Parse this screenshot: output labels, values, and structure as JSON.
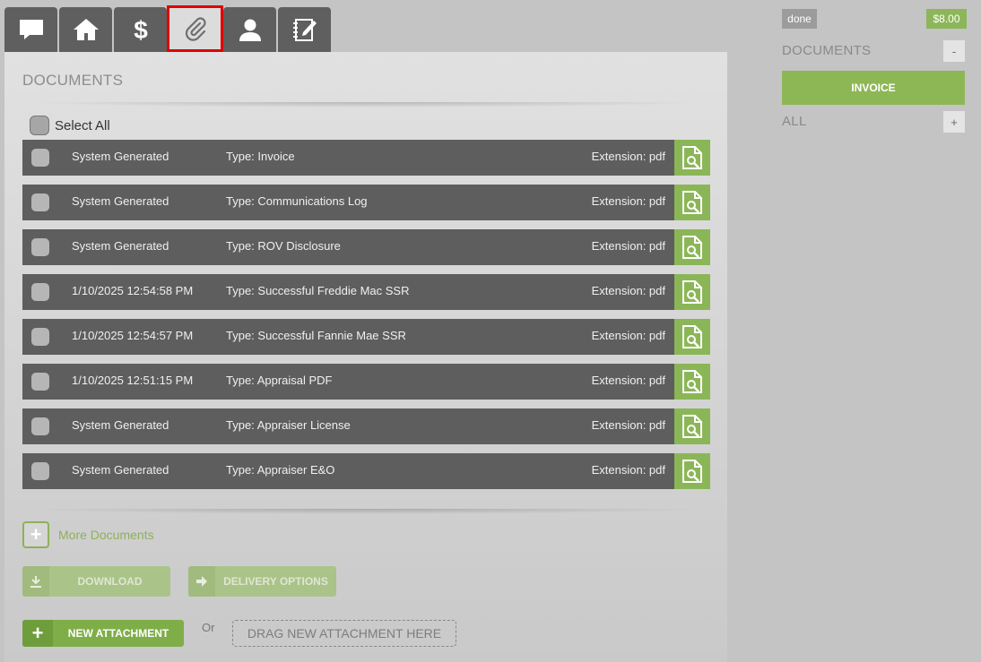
{
  "tabs": [
    {
      "icon": "chat-bubble-icon"
    },
    {
      "icon": "home-icon"
    },
    {
      "icon": "dollar-icon"
    },
    {
      "icon": "paperclip-icon",
      "active": true
    },
    {
      "icon": "user-icon"
    },
    {
      "icon": "notebook-pen-icon"
    }
  ],
  "panel": {
    "title": "DOCUMENTS",
    "select_all_label": "Select All"
  },
  "documents": [
    {
      "date": "System Generated",
      "type": "Type: Invoice",
      "ext": "Extension: pdf"
    },
    {
      "date": "System Generated",
      "type": "Type: Communications Log",
      "ext": "Extension: pdf"
    },
    {
      "date": "System Generated",
      "type": "Type: ROV Disclosure",
      "ext": "Extension: pdf"
    },
    {
      "date": "1/10/2025 12:54:58 PM",
      "type": "Type: Successful Freddie Mac SSR",
      "ext": "Extension: pdf"
    },
    {
      "date": "1/10/2025 12:54:57 PM",
      "type": "Type: Successful Fannie Mae SSR",
      "ext": "Extension: pdf"
    },
    {
      "date": "1/10/2025 12:51:15 PM",
      "type": "Type: Appraisal PDF",
      "ext": "Extension: pdf"
    },
    {
      "date": "System Generated",
      "type": "Type: Appraiser License",
      "ext": "Extension: pdf"
    },
    {
      "date": "System Generated",
      "type": "Type: Appraiser E&O",
      "ext": "Extension: pdf"
    }
  ],
  "actions": {
    "more_documents": "More Documents",
    "download": "DOWNLOAD",
    "delivery_options": "DELIVERY OPTIONS",
    "new_attachment": "NEW ATTACHMENT",
    "or": "Or",
    "drag_here": "DRAG NEW ATTACHMENT HERE"
  },
  "sidebar": {
    "status": "done",
    "price": "$8.00",
    "documents_label": "DOCUMENTS",
    "documents_toggle": "-",
    "invoice_button": "INVOICE",
    "all_label": "ALL",
    "all_toggle": "+"
  },
  "colors": {
    "accent_green": "#8db755",
    "row_bg": "#5e5e5e",
    "highlight_red": "#e00000"
  }
}
